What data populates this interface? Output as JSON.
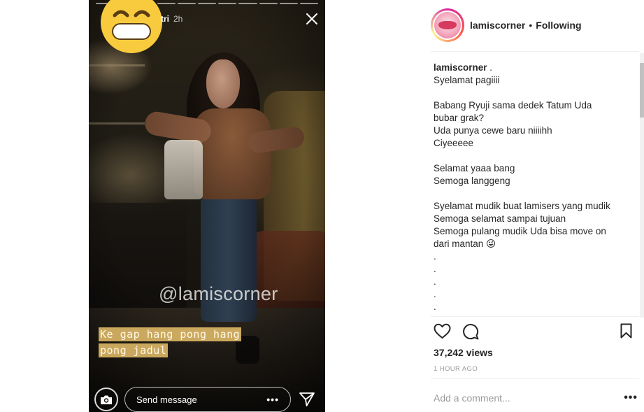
{
  "story": {
    "username": "tri",
    "time_ago": "2h",
    "watermark": "@lamiscorner",
    "overlay_text": [
      "Ke gap hang pong hang",
      "pong jadul"
    ],
    "reply_placeholder": "Send message",
    "more_label": "•••",
    "emoji": "grinning-face-emoji",
    "progress_segments": 11
  },
  "post": {
    "author": "lamiscorner",
    "separator": "•",
    "follow_status": "Following",
    "caption_author": "lamiscorner",
    "caption_lines": [
      " .",
      "Syelamat pagiiii",
      "",
      "Babang Ryuji sama dedek Tatum Uda",
      "bubar grak?",
      "Uda punya cewe baru niiiihh",
      "Ciyeeeee",
      "",
      "Selamat yaaa bang",
      "Semoga langgeng",
      "",
      "Syelamat mudik buat lamisers yang mudik",
      "Semoga selamat sampai tujuan",
      "Semoga pulang mudik Uda bisa move on",
      "dari mantan 😜",
      ".",
      ".",
      ".",
      ".",
      "."
    ],
    "views": "37,242 views",
    "time_ago": "1 HOUR AGO",
    "comment_placeholder": "Add a comment...",
    "comment_more": "•••"
  },
  "colors": {
    "text": "#262626",
    "muted": "#999999",
    "divider": "#efefef",
    "story_bg": "#141210",
    "caption_highlight": "#f0c86e"
  }
}
